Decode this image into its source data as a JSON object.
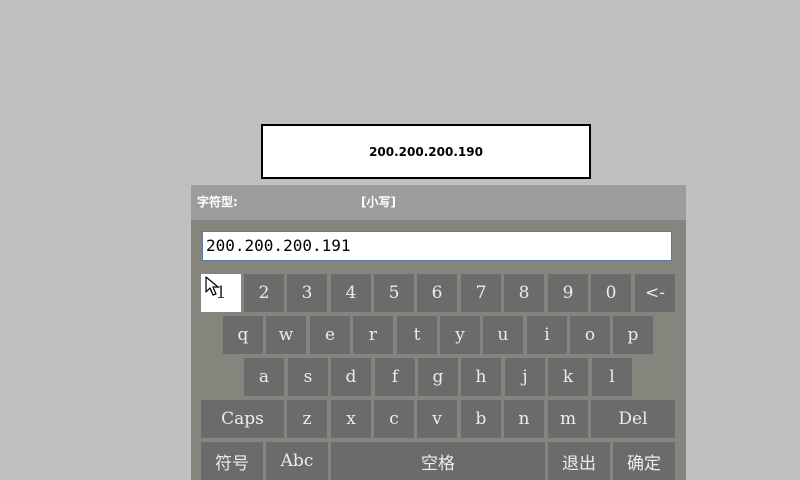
{
  "display": {
    "ip": "200.200.200.190"
  },
  "keyboard": {
    "mode_label": "字符型:",
    "case_label": "[小写]",
    "input_value": "200.200.200.191",
    "rows": [
      [
        "1",
        "2",
        "3",
        "4",
        "5",
        "6",
        "7",
        "8",
        "9",
        "0",
        "<-"
      ],
      [
        "q",
        "w",
        "e",
        "r",
        "t",
        "y",
        "u",
        "i",
        "o",
        "p"
      ],
      [
        "a",
        "s",
        "d",
        "f",
        "g",
        "h",
        "j",
        "k",
        "l"
      ],
      [
        "Caps",
        "z",
        "x",
        "c",
        "v",
        "b",
        "n",
        "m",
        "Del"
      ],
      [
        "符号",
        "Abc",
        "空格",
        "退出",
        "确定"
      ]
    ],
    "pressed_key": "1"
  },
  "icons": {
    "cursor": "mouse-pointer-icon"
  },
  "colors": {
    "background": "#c0c0c0",
    "panel": "#85857d",
    "header": "#9c9c9c",
    "key": "#6b6b6b",
    "key_text": "#ececec",
    "key_pressed": "#ffffff"
  }
}
